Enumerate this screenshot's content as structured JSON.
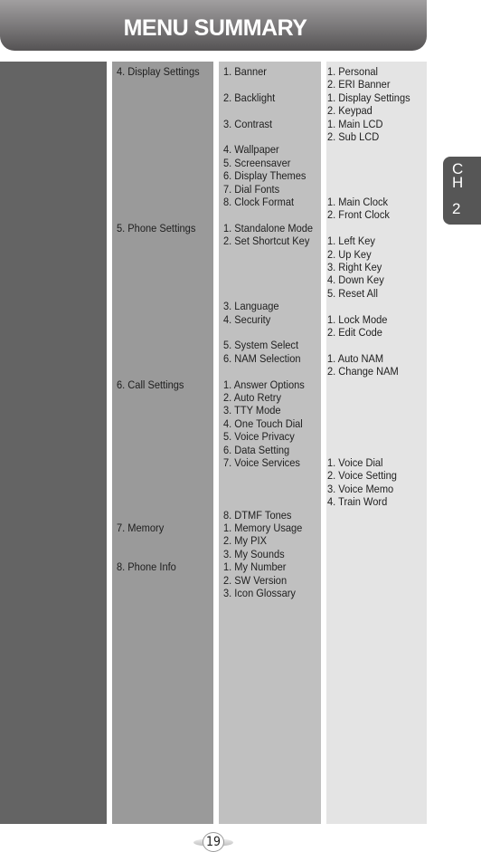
{
  "header": {
    "title": "MENU SUMMARY"
  },
  "chapter_tab": {
    "letter1": "C",
    "letter2": "H",
    "number": "2"
  },
  "page_number": "19",
  "columns": {
    "level1": [],
    "level2": [
      {
        "label": "4. Display Settings",
        "row": 0
      },
      {
        "label": "5. Phone Settings",
        "row": 12
      },
      {
        "label": "6. Call Settings",
        "row": 24
      },
      {
        "label": "7. Memory",
        "row": 35
      },
      {
        "label": "8. Phone Info",
        "row": 38
      }
    ],
    "level3": [
      {
        "label": "1. Banner",
        "row": 0
      },
      {
        "label": "2. Backlight",
        "row": 2
      },
      {
        "label": "3. Contrast",
        "row": 4
      },
      {
        "label": "4. Wallpaper",
        "row": 6
      },
      {
        "label": "5. Screensaver",
        "row": 7
      },
      {
        "label": "6. Display Themes",
        "row": 8
      },
      {
        "label": "7. Dial Fonts",
        "row": 9
      },
      {
        "label": "8. Clock Format",
        "row": 10
      },
      {
        "label": "1. Standalone Mode",
        "row": 12
      },
      {
        "label": "2. Set Shortcut Key",
        "row": 13
      },
      {
        "label": "3. Language",
        "row": 18
      },
      {
        "label": "4. Security",
        "row": 19
      },
      {
        "label": "5. System Select",
        "row": 21
      },
      {
        "label": "6. NAM Selection",
        "row": 22
      },
      {
        "label": "1. Answer Options",
        "row": 24
      },
      {
        "label": "2. Auto Retry",
        "row": 25
      },
      {
        "label": "3. TTY Mode",
        "row": 26
      },
      {
        "label": "4. One Touch Dial",
        "row": 27
      },
      {
        "label": "5. Voice Privacy",
        "row": 28
      },
      {
        "label": "6. Data Setting",
        "row": 29
      },
      {
        "label": "7. Voice Services",
        "row": 30
      },
      {
        "label": "8. DTMF Tones",
        "row": 34
      },
      {
        "label": "1. Memory Usage",
        "row": 35
      },
      {
        "label": "2. My PIX",
        "row": 36
      },
      {
        "label": "3. My Sounds",
        "row": 37
      },
      {
        "label": "1. My Number",
        "row": 38
      },
      {
        "label": "2. SW Version",
        "row": 39
      },
      {
        "label": "3. Icon Glossary",
        "row": 40
      }
    ],
    "level4": [
      {
        "label": "1. Personal",
        "row": 0
      },
      {
        "label": "2. ERI Banner",
        "row": 1
      },
      {
        "label": "1. Display Settings",
        "row": 2
      },
      {
        "label": "2. Keypad",
        "row": 3
      },
      {
        "label": "1. Main LCD",
        "row": 4
      },
      {
        "label": "2. Sub LCD",
        "row": 5
      },
      {
        "label": "1. Main Clock",
        "row": 10
      },
      {
        "label": "2. Front Clock",
        "row": 11
      },
      {
        "label": "1. Left Key",
        "row": 13
      },
      {
        "label": "2. Up Key",
        "row": 14
      },
      {
        "label": "3. Right Key",
        "row": 15
      },
      {
        "label": "4. Down Key",
        "row": 16
      },
      {
        "label": "5. Reset All",
        "row": 17
      },
      {
        "label": "1. Lock Mode",
        "row": 19
      },
      {
        "label": "2. Edit Code",
        "row": 20
      },
      {
        "label": "1. Auto NAM",
        "row": 22
      },
      {
        "label": "2. Change NAM",
        "row": 23
      },
      {
        "label": "1. Voice Dial",
        "row": 30
      },
      {
        "label": "2. Voice Setting",
        "row": 31
      },
      {
        "label": "3. Voice Memo",
        "row": 32
      },
      {
        "label": "4. Train Word",
        "row": 33
      }
    ]
  }
}
